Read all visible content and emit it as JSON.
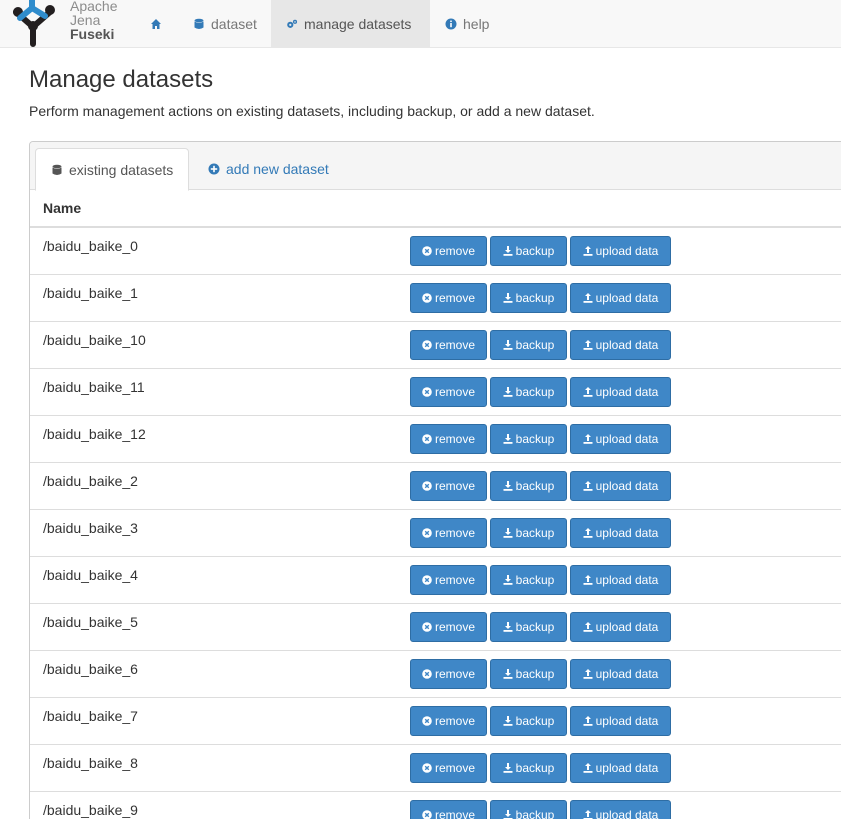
{
  "brand": {
    "line1": "Apache",
    "line2": "Jena",
    "line3": "Fuseki"
  },
  "nav": {
    "home_icon": "home-icon",
    "dataset": "dataset",
    "manage": "manage datasets",
    "help": "help"
  },
  "page": {
    "title": "Manage datasets",
    "description": "Perform management actions on existing datasets, including backup, or add a new dataset."
  },
  "tabs": {
    "existing": "existing datasets",
    "add": "add new dataset"
  },
  "table": {
    "header": "Name",
    "remove_label": "remove",
    "backup_label": "backup",
    "upload_label": "upload data",
    "rows": [
      "/baidu_baike_0",
      "/baidu_baike_1",
      "/baidu_baike_10",
      "/baidu_baike_11",
      "/baidu_baike_12",
      "/baidu_baike_2",
      "/baidu_baike_3",
      "/baidu_baike_4",
      "/baidu_baike_5",
      "/baidu_baike_6",
      "/baidu_baike_7",
      "/baidu_baike_8",
      "/baidu_baike_9"
    ]
  },
  "colors": {
    "primary": "#3f87c7",
    "link": "#337ab7",
    "navbar": "#f8f8f8",
    "logo_blue": "#2f8ccc",
    "logo_dark": "#231f20"
  }
}
